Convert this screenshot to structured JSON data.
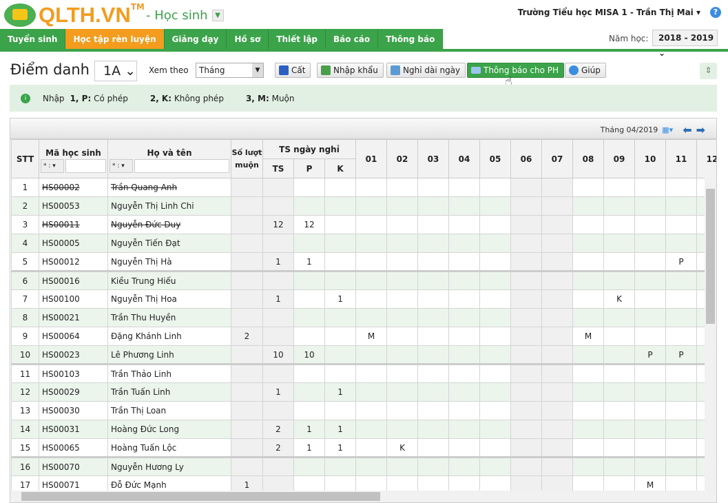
{
  "header": {
    "logo": "QLTH.VN",
    "tm": "TM",
    "module": "- Học sinh",
    "user": "Trường Tiểu học MISA 1 - Trần Thị Mai ▾",
    "help": "?"
  },
  "nav": [
    {
      "label": "Tuyển sinh"
    },
    {
      "label": "Học tập rèn luyện",
      "active": true
    },
    {
      "label": "Giảng dạy"
    },
    {
      "label": "Hồ sơ"
    },
    {
      "label": "Thiết lập"
    },
    {
      "label": "Báo cáo"
    },
    {
      "label": "Thông báo"
    }
  ],
  "year": {
    "label": "Năm học:",
    "value": "2018 - 2019 ⌄"
  },
  "toolbar": {
    "title": "Điểm danh",
    "class": "1A ⌄",
    "view_label": "Xem theo",
    "view_value": "Tháng",
    "save": "Cất",
    "import": "Nhập khẩu",
    "long_leave": "Nghỉ dài ngày",
    "notify": "Thông báo cho PH",
    "help": "Giúp"
  },
  "legend": {
    "prefix": "Nhập",
    "items": [
      {
        "key": "1, P:",
        "text": "Có phép"
      },
      {
        "key": "2, K:",
        "text": "Không phép"
      },
      {
        "key": "3, M:",
        "text": "Muộn"
      }
    ]
  },
  "grid": {
    "month": "Tháng 04/2019",
    "headers": {
      "stt": "STT",
      "code": "Mã học sinh",
      "name": "Họ và tên",
      "late": "Số lượt muộn",
      "absent": "TS ngày nghỉ",
      "ts": "TS",
      "p": "P",
      "k": "K",
      "filter_op": "* : ▾"
    },
    "days": [
      "01",
      "02",
      "03",
      "04",
      "05",
      "06",
      "07",
      "08",
      "09",
      "10",
      "11",
      "12"
    ],
    "weekend_days": [
      "06",
      "07"
    ],
    "rows": [
      {
        "stt": "1",
        "code": "HS00002",
        "name": "Trần Quang Anh",
        "struck": true,
        "late": "",
        "ts": "",
        "p": "",
        "k": "",
        "marks": {}
      },
      {
        "stt": "2",
        "code": "HS00053",
        "name": "Nguyễn Thị Linh Chi",
        "late": "",
        "ts": "",
        "p": "",
        "k": "",
        "marks": {}
      },
      {
        "stt": "3",
        "code": "HS00011",
        "name": "Nguyễn Đức Duy",
        "struck": true,
        "late": "",
        "ts": "12",
        "p": "12",
        "k": "",
        "marks": {}
      },
      {
        "stt": "4",
        "code": "HS00005",
        "name": "Nguyễn Tiến Đạt",
        "late": "",
        "ts": "",
        "p": "",
        "k": "",
        "marks": {}
      },
      {
        "stt": "5",
        "code": "HS00012",
        "name": "Nguyễn Thị Hà",
        "late": "",
        "ts": "1",
        "p": "1",
        "k": "",
        "marks": {
          "11": "P"
        }
      },
      {
        "stt": "6",
        "code": "HS00016",
        "name": "Kiều Trung Hiếu",
        "late": "",
        "ts": "",
        "p": "",
        "k": "",
        "marks": {}
      },
      {
        "stt": "7",
        "code": "HS00100",
        "name": "Nguyễn Thị Hoa",
        "late": "",
        "ts": "1",
        "p": "",
        "k": "1",
        "marks": {
          "09": "K"
        }
      },
      {
        "stt": "8",
        "code": "HS00021",
        "name": "Trần Thu Huyền",
        "late": "",
        "ts": "",
        "p": "",
        "k": "",
        "marks": {}
      },
      {
        "stt": "9",
        "code": "HS00064",
        "name": "Đặng Khánh Linh",
        "late": "2",
        "ts": "",
        "p": "",
        "k": "",
        "marks": {
          "01": "M",
          "08": "M"
        }
      },
      {
        "stt": "10",
        "code": "HS00023",
        "name": "Lê Phương Linh",
        "late": "",
        "ts": "10",
        "p": "10",
        "k": "",
        "marks": {
          "10": "P",
          "11": "P"
        }
      },
      {
        "stt": "11",
        "code": "HS00103",
        "name": "Trần Thảo Linh",
        "late": "",
        "ts": "",
        "p": "",
        "k": "",
        "marks": {}
      },
      {
        "stt": "12",
        "code": "HS00029",
        "name": "Trần Tuấn Linh",
        "late": "",
        "ts": "1",
        "p": "",
        "k": "1",
        "marks": {}
      },
      {
        "stt": "13",
        "code": "HS00030",
        "name": "Trần Thị Loan",
        "late": "",
        "ts": "",
        "p": "",
        "k": "",
        "marks": {}
      },
      {
        "stt": "14",
        "code": "HS00031",
        "name": "Hoàng Đức Long",
        "late": "",
        "ts": "2",
        "p": "1",
        "k": "1",
        "marks": {}
      },
      {
        "stt": "15",
        "code": "HS00065",
        "name": "Hoàng Tuấn Lộc",
        "late": "",
        "ts": "2",
        "p": "1",
        "k": "1",
        "marks": {
          "02": "K"
        }
      },
      {
        "stt": "16",
        "code": "HS00070",
        "name": "Nguyễn Hương Ly",
        "late": "",
        "ts": "",
        "p": "",
        "k": "",
        "marks": {}
      },
      {
        "stt": "17",
        "code": "HS00071",
        "name": "Đỗ Đức Mạnh",
        "late": "1",
        "ts": "",
        "p": "",
        "k": "",
        "marks": {
          "10": "M"
        }
      }
    ]
  }
}
